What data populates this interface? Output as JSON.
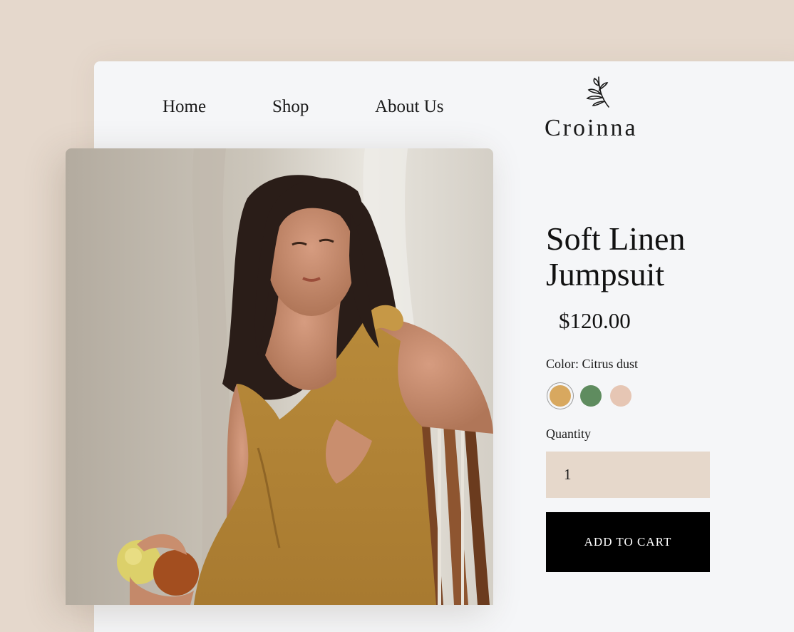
{
  "nav": {
    "items": [
      {
        "label": "Home"
      },
      {
        "label": "Shop"
      },
      {
        "label": "About Us"
      }
    ]
  },
  "logo": {
    "text": "Croinna",
    "icon": "leaf-sprig-icon"
  },
  "product": {
    "title": "Soft Linen Jumpsuit",
    "price": "$120.00",
    "color_label": "Color: Citrus dust",
    "swatches": [
      {
        "name": "Citrus dust",
        "color": "#d8a85f",
        "selected": true
      },
      {
        "name": "green",
        "color": "#5f8c5f",
        "selected": false
      },
      {
        "name": "blush",
        "color": "#e6c6b4",
        "selected": false
      }
    ],
    "quantity_label": "Quantity",
    "quantity_value": "1",
    "add_to_cart_label": "ADD TO CART"
  },
  "colors": {
    "page_background": "#e5d8cc",
    "card_background": "#f5f6f8",
    "quantity_field": "#e6d8cb",
    "button": "#000000"
  }
}
